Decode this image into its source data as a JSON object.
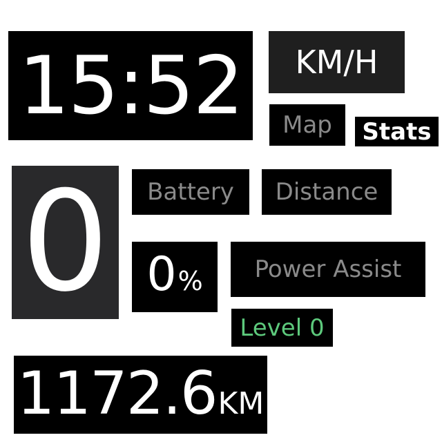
{
  "header": {
    "clock": "15:52",
    "unit_toggle_label": "KM/H"
  },
  "tabs": [
    {
      "label": "Map",
      "active": false
    },
    {
      "label": "Stats",
      "active": true
    }
  ],
  "speed": {
    "value": "0"
  },
  "labels": {
    "battery": "Battery",
    "distance": "Distance",
    "power_assist": "Power Assist"
  },
  "battery": {
    "value": "0",
    "unit": "%"
  },
  "assist": {
    "level_text": "Level 0"
  },
  "odometer": {
    "value": "1172.6",
    "unit": "KM"
  },
  "colors": {
    "panel": "#000000",
    "speed_panel": "#29292b",
    "unit_panel": "#1f1f1f",
    "label_text": "#8a8a8a",
    "value_text": "#ffffff",
    "assist_level_text": "#5dc97c"
  }
}
